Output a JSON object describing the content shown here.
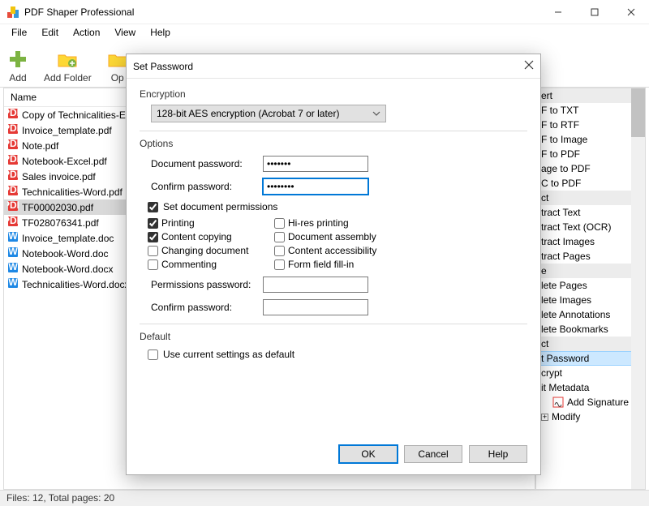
{
  "window": {
    "title": "PDF Shaper Professional"
  },
  "menu": {
    "file": "File",
    "edit": "Edit",
    "action": "Action",
    "view": "View",
    "help": "Help"
  },
  "toolbar": {
    "add": "Add",
    "add_folder": "Add Folder",
    "open_truncated": "Op"
  },
  "file_panel": {
    "header": "Name",
    "files": [
      {
        "name": "Copy of Technicalities-Excel",
        "icon": "pdf"
      },
      {
        "name": "Invoice_template.pdf",
        "icon": "pdf"
      },
      {
        "name": "Note.pdf",
        "icon": "pdf"
      },
      {
        "name": "Notebook-Excel.pdf",
        "icon": "pdf"
      },
      {
        "name": "Sales invoice.pdf",
        "icon": "pdf"
      },
      {
        "name": "Technicalities-Word.pdf",
        "icon": "pdf"
      },
      {
        "name": "TF00002030.pdf",
        "icon": "pdf",
        "selected": true
      },
      {
        "name": "TF028076341.pdf",
        "icon": "pdf"
      },
      {
        "name": "Invoice_template.doc",
        "icon": "doc"
      },
      {
        "name": "Notebook-Word.doc",
        "icon": "doc"
      },
      {
        "name": "Notebook-Word.docx",
        "icon": "doc"
      },
      {
        "name": "Technicalities-Word.docx",
        "icon": "doc"
      }
    ]
  },
  "right_panel": {
    "sections": [
      {
        "header": "ert",
        "items": [
          "F to TXT",
          "F to RTF",
          "F to Image",
          "F to PDF",
          "age to PDF",
          "C to PDF"
        ]
      },
      {
        "header": "ct",
        "items": [
          "tract Text",
          "tract Text (OCR)",
          "tract Images",
          "tract Pages"
        ]
      },
      {
        "header": "e",
        "items": [
          "lete Pages",
          "lete Images",
          "lete Annotations",
          "lete Bookmarks"
        ]
      },
      {
        "header": "ct",
        "items": [
          {
            "t": "t Password",
            "hl": true
          },
          "crypt",
          "it Metadata",
          {
            "t": "Add Signature",
            "indent": true
          }
        ]
      },
      {
        "header_plus": "Modify"
      }
    ]
  },
  "status": "Files: 12, Total pages: 20",
  "dialog": {
    "title": "Set Password",
    "encryption_label": "Encryption",
    "encryption_value": "128-bit AES encryption (Acrobat 7 or later)",
    "options_label": "Options",
    "doc_pw_label": "Document password:",
    "doc_pw_value": "•••••••",
    "confirm_pw_label": "Confirm password:",
    "confirm_pw_value": "••••••••",
    "set_permissions": "Set document permissions",
    "perms": {
      "printing": "Printing",
      "content_copying": "Content copying",
      "changing_document": "Changing document",
      "commenting": "Commenting",
      "hires_printing": "Hi-res printing",
      "doc_assembly": "Document assembly",
      "content_access": "Content accessibility",
      "form_fill": "Form field fill-in"
    },
    "perm_pw_label": "Permissions password:",
    "perm_confirm_label": "Confirm password:",
    "default_label": "Default",
    "use_default": "Use current settings as default",
    "ok": "OK",
    "cancel": "Cancel",
    "help": "Help"
  }
}
